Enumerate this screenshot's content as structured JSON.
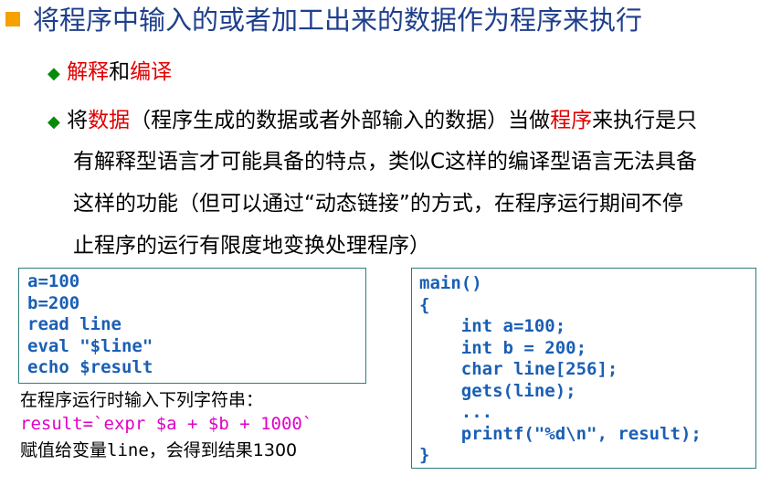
{
  "title": "将程序中输入的或者加工出来的数据作为程序来执行",
  "bullet1": {
    "part1": "解释",
    "part2": "和",
    "part3": "编译"
  },
  "bullet2": {
    "line1_a": "将",
    "line1_b": "数据",
    "line1_c": "（程序生成的数据或者外部输入的数据）当做",
    "line1_d": "程序",
    "line1_e": "来执行是只",
    "line2": "有解释型语言才可能具备的特点，类似C这样的编译型语言无法具备",
    "line3": "这样的功能（但可以通过“动态链接”的方式，在程序运行期间不停",
    "line4": "止程序的运行有限度地变换处理程序）"
  },
  "shell_code": [
    "a=100",
    "b=200",
    "read line",
    "eval \"$line\"",
    "echo $result"
  ],
  "note": {
    "line1": "在程序运行时输入下列字符串：",
    "line2": "result=`expr $a + $b + 1000`",
    "line3_a": "赋值给变量",
    "line3_b": "line",
    "line3_c": "，会得到结果1300"
  },
  "c_code": [
    "main()",
    "{",
    "    int a=100;",
    "    int b = 200;",
    "    char line[256];",
    "    gets(line);",
    "    ...",
    "    printf(\"%d\\n\", result);",
    "}"
  ],
  "colors": {
    "title": "#1f3f8c",
    "bullet": "#f5a100",
    "diamond": "#0a8a0a",
    "highlight": "#e00000",
    "code": "#1a5fb4",
    "input": "#e000c8",
    "box_border": "#2e7d7d"
  }
}
